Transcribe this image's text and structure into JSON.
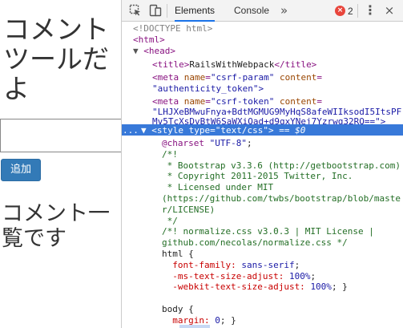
{
  "page": {
    "heading": "コメントツールだよ",
    "comment_placeholder": "",
    "add_button_label": "追加",
    "list_heading": "コメント一覧です"
  },
  "devtools": {
    "tabs": [
      {
        "label": "Elements",
        "active": true
      },
      {
        "label": "Console",
        "active": false
      }
    ],
    "more_label": "»",
    "error_count": "2",
    "error_icon_glyph": "×",
    "kebab_glyph": "⋮",
    "close_glyph": "×",
    "selection_color": "#3879d9",
    "tree": {
      "doctype": "<!DOCTYPE html>",
      "html_open": "<html>",
      "head_open": "<head>",
      "title_tag_open": "<title>",
      "title_text": "RailsWithWebpack",
      "title_tag_close": "</title>",
      "meta1_tag": "<meta",
      "meta1_name_attr": "name",
      "meta1_name_val": "\"csrf-param\"",
      "meta1_content_attr": "content",
      "meta1_content_val": "\"authenticity_token\">",
      "meta2_tag": "<meta",
      "meta2_name_attr": "name",
      "meta2_name_val": "\"csrf-token\"",
      "meta2_content_attr": "content",
      "meta2_content_val_1": "\"LHJXeBMwuFnya+BdtMGMUG9MyHqS8afeWIIksodI5ItsPF",
      "meta2_content_val_2": "Mv5TcXsDvBtW6SaWXiQad+d9gxYNej7Yzrwq32RQ==\">",
      "style_dots": "...",
      "style_tag": "<style",
      "style_type_attr": "type",
      "style_type_val": "\"text/css\"",
      "style_close": ">",
      "style_eq": "==",
      "style_ref": "$0",
      "css_lines": [
        {
          "cls": "css-at",
          "text": "@charset ",
          "str": "\"UTF-8\"",
          "tail": ";"
        },
        {
          "cls": "cm",
          "text": "/*!"
        },
        {
          "cls": "cm",
          "text": " * Bootstrap v3.3.6 (http://getbootstrap.com)"
        },
        {
          "cls": "cm",
          "text": " * Copyright 2011-2015 Twitter, Inc."
        },
        {
          "cls": "cm",
          "text": " * Licensed under MIT"
        },
        {
          "cls": "cm",
          "text": "(https://github.com/twbs/bootstrap/blob/maste"
        },
        {
          "cls": "cm",
          "text": "r/LICENSE)"
        },
        {
          "cls": "cm",
          "text": " */"
        },
        {
          "cls": "cm",
          "text": "/*! normalize.css v3.0.3 | MIT License |"
        },
        {
          "cls": "cm",
          "text": "github.com/necolas/normalize.css */"
        },
        {
          "cls": "css-rule",
          "text": "html {"
        },
        {
          "cls": "css-prop",
          "text": "  font-family: ",
          "str": "sans-serif",
          "tail": ";"
        },
        {
          "cls": "css-prop",
          "text": "  -ms-text-size-adjust: ",
          "str": "100%",
          "tail": ";"
        },
        {
          "cls": "css-prop",
          "text": "  -webkit-text-size-adjust: ",
          "str": "100%",
          "tail": "; }"
        },
        {
          "cls": "css-rule",
          "text": ""
        },
        {
          "cls": "css-rule",
          "text": "body {"
        },
        {
          "cls": "css-prop",
          "text": "  margin: ",
          "str": "0",
          "tail": "; }"
        }
      ]
    }
  }
}
